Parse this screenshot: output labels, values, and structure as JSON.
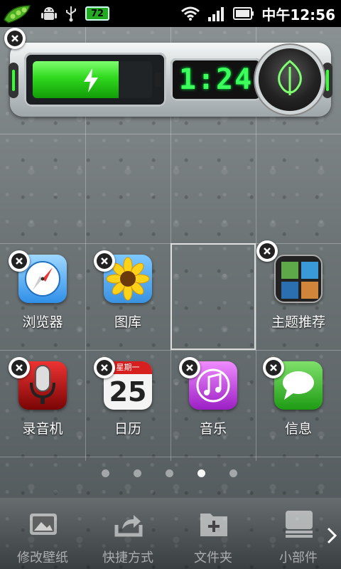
{
  "status_bar": {
    "battery_level": "72",
    "time": "中午12:56",
    "icons": [
      "pea-pod-icon",
      "android-icon",
      "usb-icon",
      "battery-badge-icon",
      "wifi-icon",
      "signal-icon",
      "battery-icon"
    ]
  },
  "widget": {
    "battery_fill": 0.72,
    "clock_time": "1:24",
    "icons": [
      "charging-bolt-icon",
      "leaf-icon"
    ]
  },
  "apps": [
    {
      "label": "浏览器",
      "icon": "safari-icon"
    },
    {
      "label": "图库",
      "icon": "gallery-sunflower-icon"
    },
    {
      "label": "主题推荐",
      "icon": "theme-icon"
    },
    {
      "label": "录音机",
      "icon": "microphone-icon"
    },
    {
      "label": "日历",
      "icon": "calendar-icon",
      "calendar_header": "星期一",
      "calendar_day": "25"
    },
    {
      "label": "音乐",
      "icon": "music-note-icon"
    },
    {
      "label": "信息",
      "icon": "message-bubble-icon"
    }
  ],
  "pager": {
    "count": 5,
    "active_index": 3
  },
  "dock": {
    "items": [
      {
        "label": "修改壁纸",
        "icon": "wallpaper-icon"
      },
      {
        "label": "快捷方式",
        "icon": "shortcut-icon"
      },
      {
        "label": "文件夹",
        "icon": "folder-icon"
      },
      {
        "label": "小部件",
        "icon": "widget-icon"
      }
    ],
    "more_icon": "chevron-right-icon"
  },
  "colors": {
    "accent_green": "#3cff5c",
    "status_bar": "#000000"
  }
}
